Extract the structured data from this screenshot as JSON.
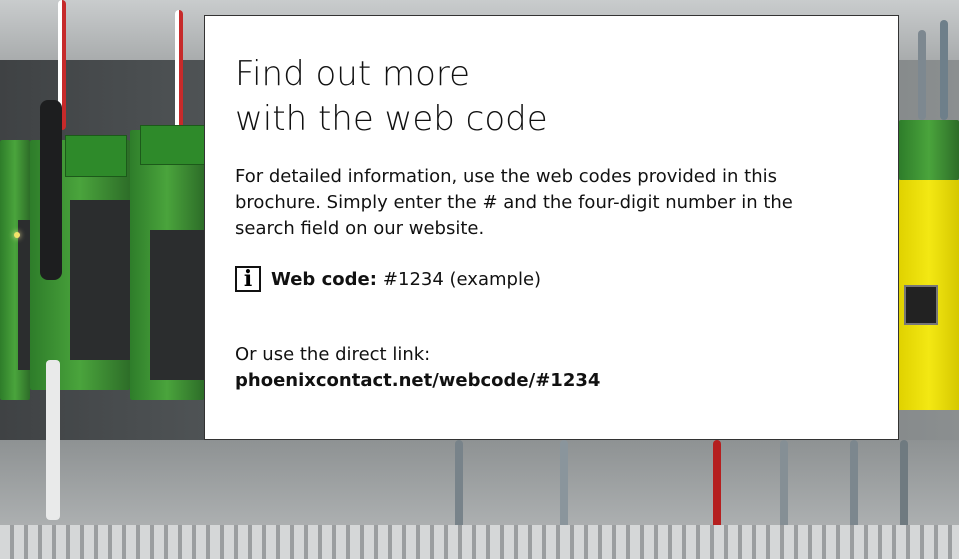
{
  "card": {
    "title_line1": "Find out more",
    "title_line2": "with the web code",
    "description": "For detailed information, use the web codes provided in this brochure. Simply enter the # and the four-digit number in the search field on our website.",
    "webcode_icon": "info-icon",
    "webcode_label": "Web code:",
    "webcode_value": "#1234 (example)",
    "link_intro": "Or use the direct link:",
    "link_url": "phoenixcontact.net/webcode/#1234"
  },
  "background": {
    "subject": "photo of green and yellow DIN-rail electronic modules with wires",
    "colors": {
      "module_green": "#4aa43c",
      "module_yellow": "#f3e813",
      "card_bg": "#ffffff"
    }
  }
}
